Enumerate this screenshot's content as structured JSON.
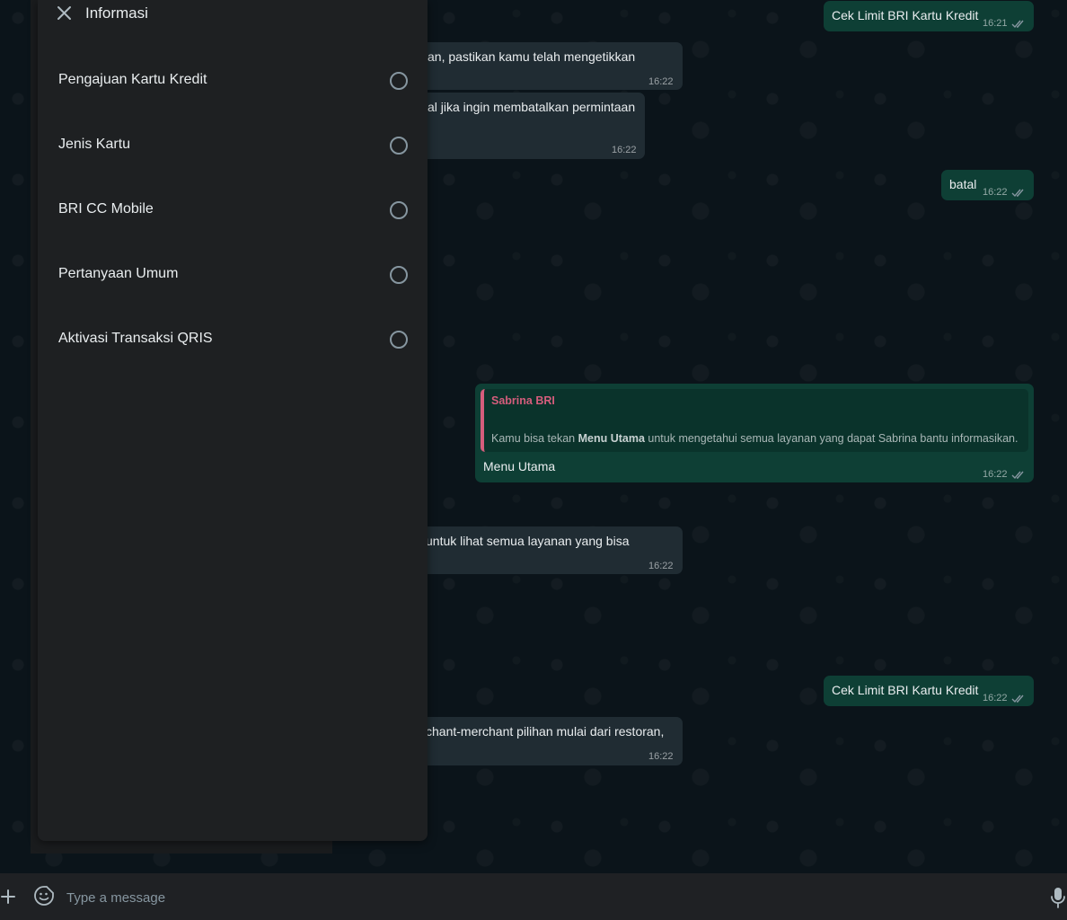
{
  "panel": {
    "title": "Informasi",
    "options": [
      {
        "label": "Pengajuan Kartu Kredit"
      },
      {
        "label": "Jenis Kartu"
      },
      {
        "label": "BRI CC Mobile"
      },
      {
        "label": "Pertanyaan Umum"
      },
      {
        "label": "Aktivasi Transaksi QRIS"
      }
    ]
  },
  "messages": [
    {
      "dir": "out",
      "text": "Cek Limit BRI Kartu Kredit",
      "time": "16:21"
    },
    {
      "dir": "in",
      "text": "an, pastikan kamu telah mengetikkan",
      "time": "16:22"
    },
    {
      "dir": "in",
      "text": "al jika ingin membatalkan permintaan",
      "time": "16:22"
    },
    {
      "dir": "out",
      "text": "batal",
      "time": "16:22"
    },
    {
      "dir": "out",
      "quote_name": "Sabrina BRI",
      "quote_pre": "Kamu bisa tekan ",
      "quote_bold": "Menu Utama",
      "quote_post": " untuk mengetahui semua layanan yang dapat Sabrina bantu informasikan.",
      "text": "Menu Utama",
      "time": "16:22"
    },
    {
      "dir": "in",
      "text": "untuk lihat semua layanan yang bisa",
      "time": "16:22"
    },
    {
      "dir": "out",
      "text": "Cek Limit BRI Kartu Kredit",
      "time": "16:22"
    },
    {
      "dir": "in",
      "text": "chant-merchant pilihan mulai dari restoran,",
      "time": "16:22"
    }
  ],
  "composer": {
    "placeholder": "Type a message"
  },
  "icons": {
    "close": "close-icon",
    "plus": "plus-icon",
    "sticker": "sticker-icon",
    "mic": "microphone-icon",
    "ticks": "double-check-icon"
  }
}
